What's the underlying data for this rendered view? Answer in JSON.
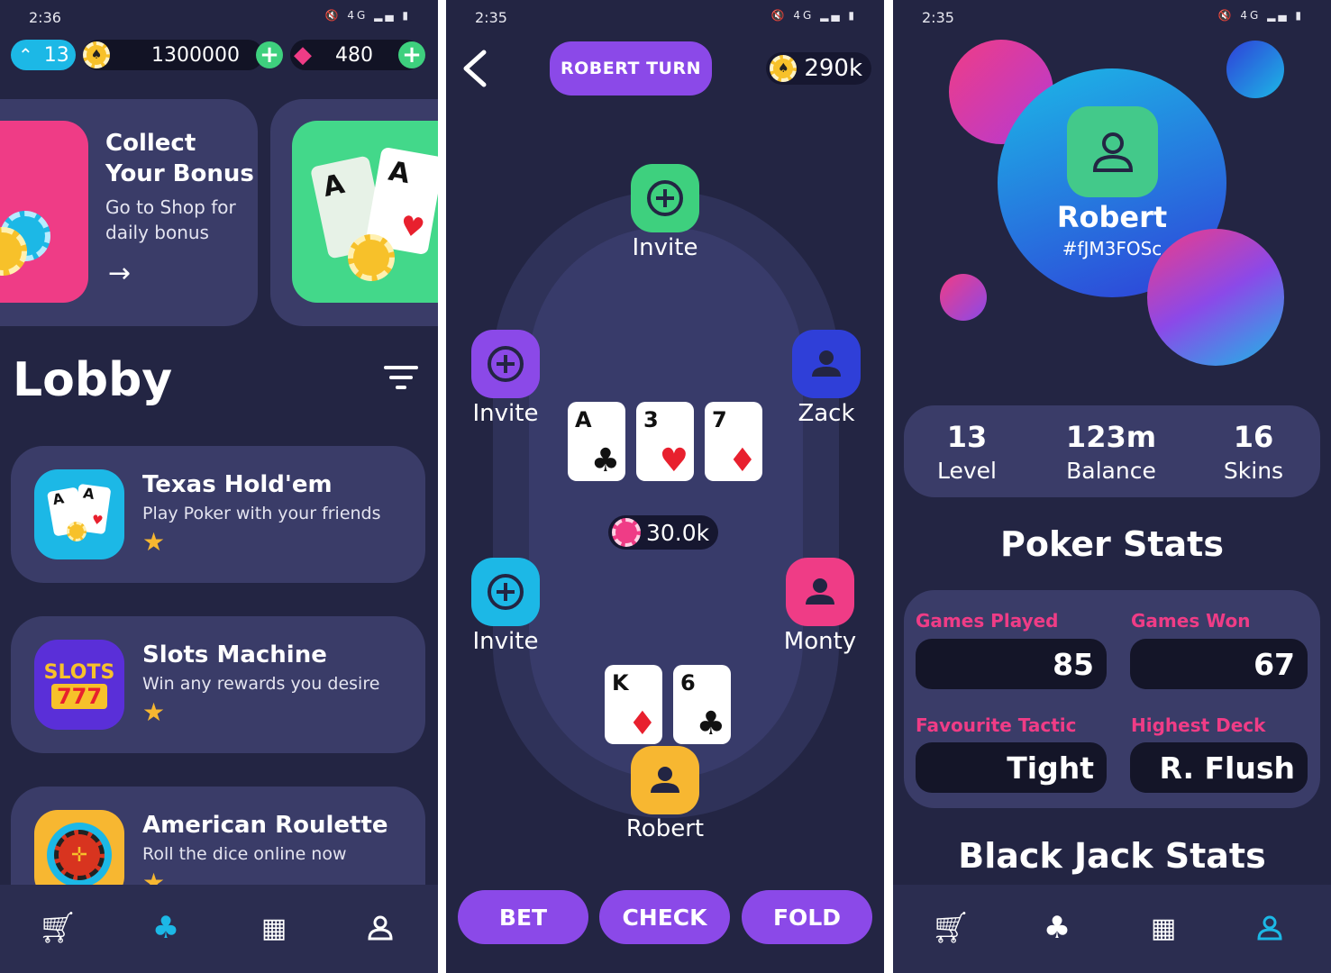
{
  "screen1": {
    "status_time": "2:36",
    "status_icons": "🔇 4G ▂▄ ▮",
    "level": "13",
    "coins": "1300000",
    "gems": "480",
    "banner": {
      "title_line1": "Collect",
      "title_line2": "Your Bonus",
      "subtitle_line1": "Go to Shop for",
      "subtitle_line2": "daily bonus"
    },
    "lobby_title": "Lobby",
    "games": [
      {
        "title": "Texas Hold'em",
        "subtitle": "Play Poker with your friends"
      },
      {
        "title": "Slots Machine",
        "subtitle": "Win any rewards you desire",
        "icon_text_top": "SLOTS",
        "icon_text_bottom": "777"
      },
      {
        "title": "American Roulette",
        "subtitle": "Roll the dice online now"
      }
    ]
  },
  "screen2": {
    "status_time": "2:35",
    "status_icons": "🔇 4G ▂▄ ▮",
    "turn_label": "ROBERT TURN",
    "chips": "290k",
    "seats": {
      "top": "Invite",
      "left_top": "Invite",
      "left_bottom": "Invite",
      "right_top": "Zack",
      "right_bottom": "Monty",
      "bottom": "Robert"
    },
    "community_cards": [
      {
        "rank": "A",
        "suit": "♣",
        "red": false
      },
      {
        "rank": "3",
        "suit": "♥",
        "red": true
      },
      {
        "rank": "7",
        "suit": "♦",
        "red": true
      }
    ],
    "pot": "30.0k",
    "hand_cards": [
      {
        "rank": "K",
        "suit": "♦",
        "red": true
      },
      {
        "rank": "6",
        "suit": "♣",
        "red": false
      }
    ],
    "actions": {
      "bet": "BET",
      "check": "CHECK",
      "fold": "FOLD"
    }
  },
  "screen3": {
    "status_time": "2:35",
    "status_icons": "🔇 4G ▂▄ ▮",
    "username": "Robert",
    "user_id": "#fJM3FOSc",
    "stats": [
      {
        "value": "13",
        "label": "Level"
      },
      {
        "value": "123m",
        "label": "Balance"
      },
      {
        "value": "16",
        "label": "Skins"
      }
    ],
    "poker_title": "Poker Stats",
    "poker_stats": {
      "games_played_label": "Games Played",
      "games_played": "85",
      "games_won_label": "Games Won",
      "games_won": "67",
      "tactic_label": "Favourite Tactic",
      "tactic": "Tight",
      "deck_label": "Highest Deck",
      "deck": "R. Flush"
    },
    "blackjack_title": "Black Jack Stats"
  },
  "colors": {
    "background": "#232543",
    "card_bg": "#3a3c68",
    "accent_purple": "#8b49e8",
    "accent_pink": "#ef3c86",
    "accent_green": "#3ed07e",
    "accent_cyan": "#1cb8e6",
    "accent_blue": "#2f3fd8",
    "accent_yellow": "#f7b731"
  }
}
